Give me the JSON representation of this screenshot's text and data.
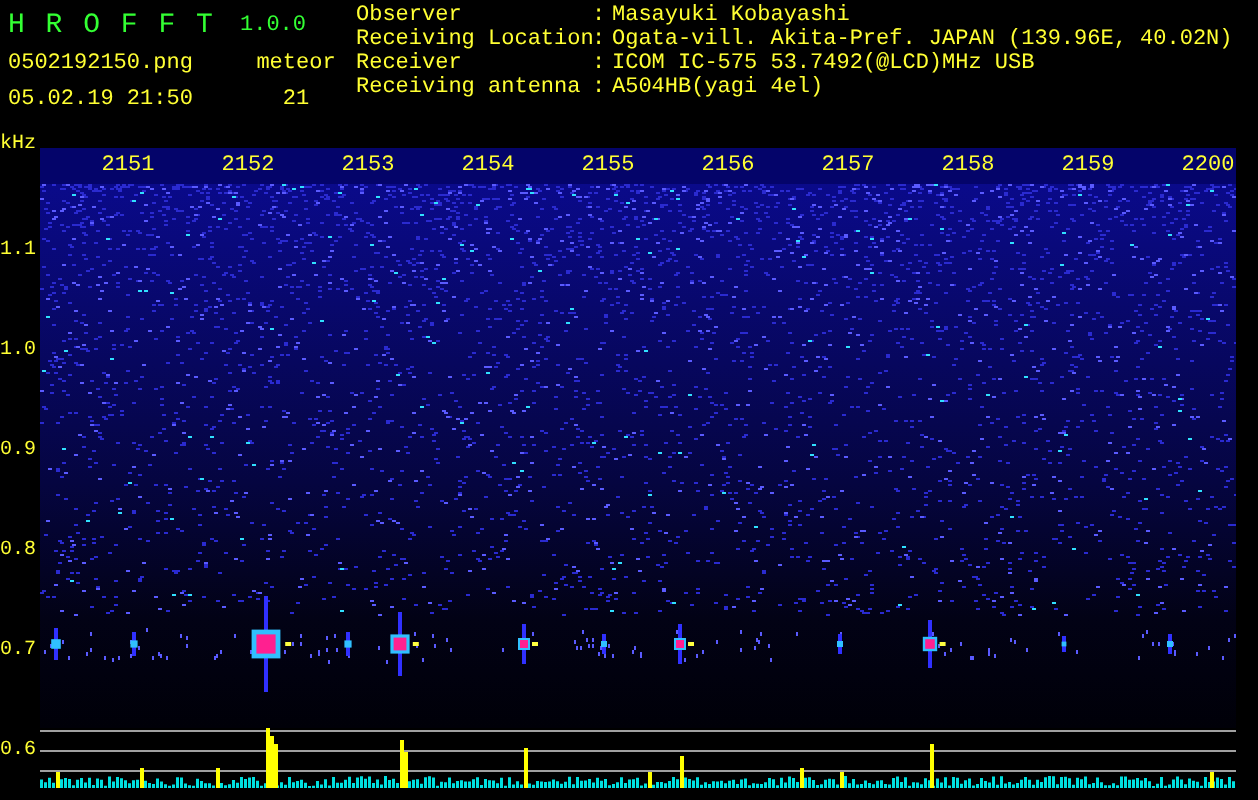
{
  "app": {
    "title": "H R O F F T",
    "version": "1.0.0",
    "file_name": "0502192150.png",
    "date_time": "05.02.19 21:50",
    "counter": {
      "label": "meteor",
      "value": "21"
    }
  },
  "station_info": [
    {
      "label": "Observer",
      "separator": ":",
      "value": "Masayuki Kobayashi"
    },
    {
      "label": "Receiving Location",
      "separator": ":",
      "value": "Ogata-vill. Akita-Pref. JAPAN (139.96E, 40.02N)"
    },
    {
      "label": "Receiver",
      "separator": ":",
      "value": "ICOM IC-575 53.7492(@LCD)MHz USB"
    },
    {
      "label": "Receiving antenna",
      "separator": ":",
      "value": "A504HB(yagi 4el)"
    }
  ],
  "frequency_unit": "kHz",
  "time_axis": {
    "labels": [
      "2151",
      "2152",
      "2153",
      "2154",
      "2155",
      "2156",
      "2157",
      "2158",
      "2159",
      "2200"
    ]
  },
  "frequency_axis": {
    "labels": [
      "1.1",
      "1.0",
      "0.9",
      "0.8",
      "0.7",
      "0.6"
    ]
  }
}
